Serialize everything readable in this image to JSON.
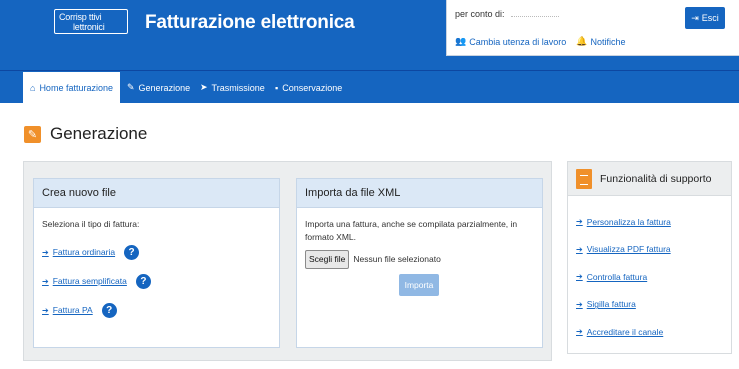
{
  "header": {
    "logo_line1": "Corrisp  ttivi",
    "logo_line2": "lettronici",
    "app_title": "Fatturazione elettronica",
    "per_conto_label": "per conto di:",
    "exit_label": "Esci",
    "change_user_label": "Cambia utenza di lavoro",
    "notifications_label": "Notifiche"
  },
  "nav": {
    "items": [
      {
        "label": "Home fatturazione",
        "icon": "home-icon"
      },
      {
        "label": "Generazione",
        "icon": "pencil-icon"
      },
      {
        "label": "Trasmissione",
        "icon": "send-icon"
      },
      {
        "label": "Conservazione",
        "icon": "archive-icon"
      }
    ],
    "active_index": 0
  },
  "page": {
    "title": "Generazione"
  },
  "create_card": {
    "title": "Crea nuovo file",
    "instruction": "Seleziona il tipo di fattura:",
    "choices": [
      "Fattura ordinaria",
      "Fattura semplificata",
      "Fattura PA"
    ],
    "help_symbol": "?"
  },
  "import_card": {
    "title": "Importa da file XML",
    "description": "Importa una fattura, anche se compilata parzialmente, in formato XML.",
    "file_button": "Scegli file",
    "file_status": "Nessun file selezionato",
    "import_button": "Importa"
  },
  "support": {
    "title": "Funzionalità di supporto",
    "links": [
      "Personalizza la fattura",
      "Visualizza PDF fattura",
      "Controlla fattura",
      "Sigilla fattura",
      "Accreditare il canale"
    ]
  },
  "colors": {
    "primary_blue": "#1565c0",
    "accent_orange": "#f0902a",
    "card_header": "#dbe8f6",
    "panel_bg": "#eceeef"
  }
}
